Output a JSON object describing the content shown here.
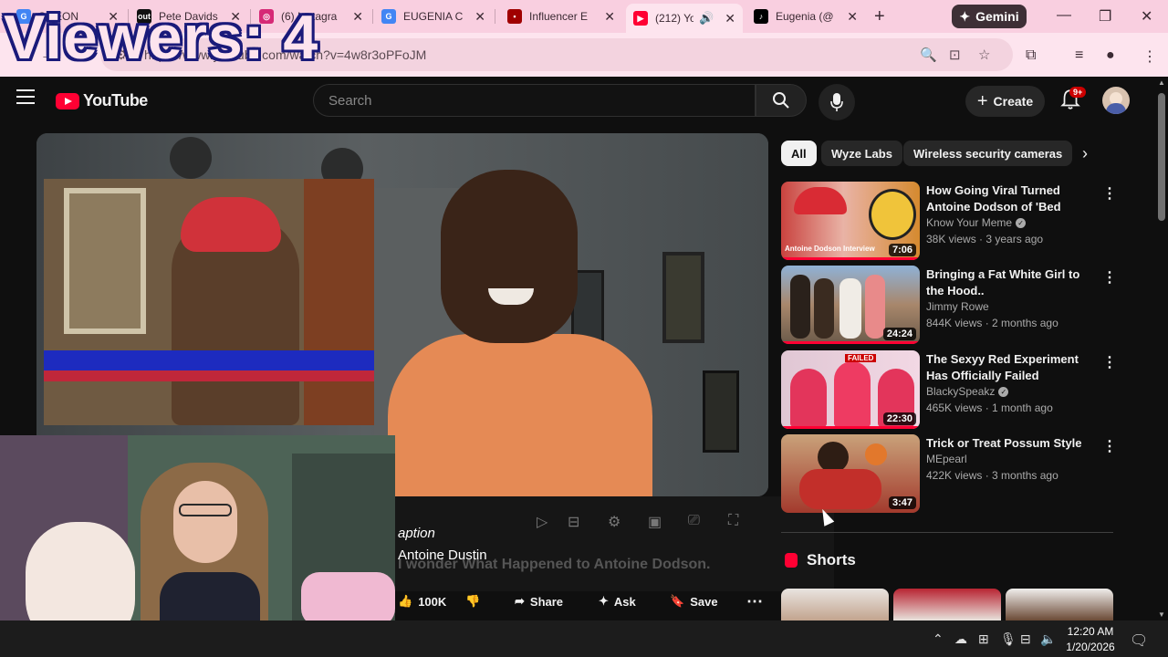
{
  "overlay": {
    "viewers": "Viewers: 4"
  },
  "browser": {
    "tabs": [
      {
        "label": "S LEON",
        "favicon": "google-icon",
        "color": "#4285f4"
      },
      {
        "label": "Pete Davids",
        "favicon": "out-icon",
        "color": "#111111"
      },
      {
        "label": "(6) Instagra",
        "favicon": "instagram-icon",
        "color": "#d62976"
      },
      {
        "label": "EUGENIA C",
        "favicon": "google-icon",
        "color": "#4285f4"
      },
      {
        "label": "Influencer E",
        "favicon": "site-icon",
        "color": "#a00000"
      },
      {
        "label": "(212) Yo",
        "favicon": "youtube-icon",
        "color": "#ff0033",
        "active": true
      },
      {
        "label": "Eugenia (@",
        "favicon": "tiktok-icon",
        "color": "#000000"
      }
    ],
    "new_tab": "+",
    "gemini_label": "Gemini",
    "url": "https://www.youtube.com/watch?v=4w8r3oPFoJM"
  },
  "youtube": {
    "logo_text": "YouTube",
    "search_placeholder": "Search",
    "create_label": "Create",
    "notif_badge": "9+"
  },
  "chips": [
    "All",
    "Wyze Labs",
    "Wireless security cameras"
  ],
  "player": {
    "caption_line1": "aption",
    "caption_line2": "Antoine Dustin",
    "title_ghost": "I wonder What Happened to Antoine Dodson."
  },
  "actions": {
    "likes": "100K",
    "share": "Share",
    "ask": "Ask",
    "save": "Save"
  },
  "recommendations": [
    {
      "title": "How Going Viral Turned Antoine Dodson of 'Bed Intruder' Fame'...",
      "channel": "Know Your Meme",
      "verified": true,
      "meta": "38K views · 3 years ago",
      "duration": "7:06",
      "thumb_label": "Antoine Dodson Interview",
      "progress": 1.0
    },
    {
      "title": "Bringing a Fat White Girl to the Hood..",
      "channel": "Jimmy Rowe",
      "verified": false,
      "meta": "844K views · 2 months ago",
      "duration": "24:24",
      "progress": 1.0
    },
    {
      "title": "The Sexyy Red Experiment Has Officially Failed",
      "channel": "BlackySpeakz",
      "verified": true,
      "meta": "465K views · 1 month ago",
      "duration": "22:30",
      "thumb_label": "FAILED",
      "progress": 1.0
    },
    {
      "title": "Trick or Treat  Possum Style",
      "channel": "MEpearl",
      "verified": false,
      "meta": "422K views · 3 months ago",
      "duration": "3:47",
      "progress": 0
    }
  ],
  "shorts_title": "Shorts",
  "taskbar": {
    "time": "12:20 AM",
    "date": "1/20/2026"
  }
}
